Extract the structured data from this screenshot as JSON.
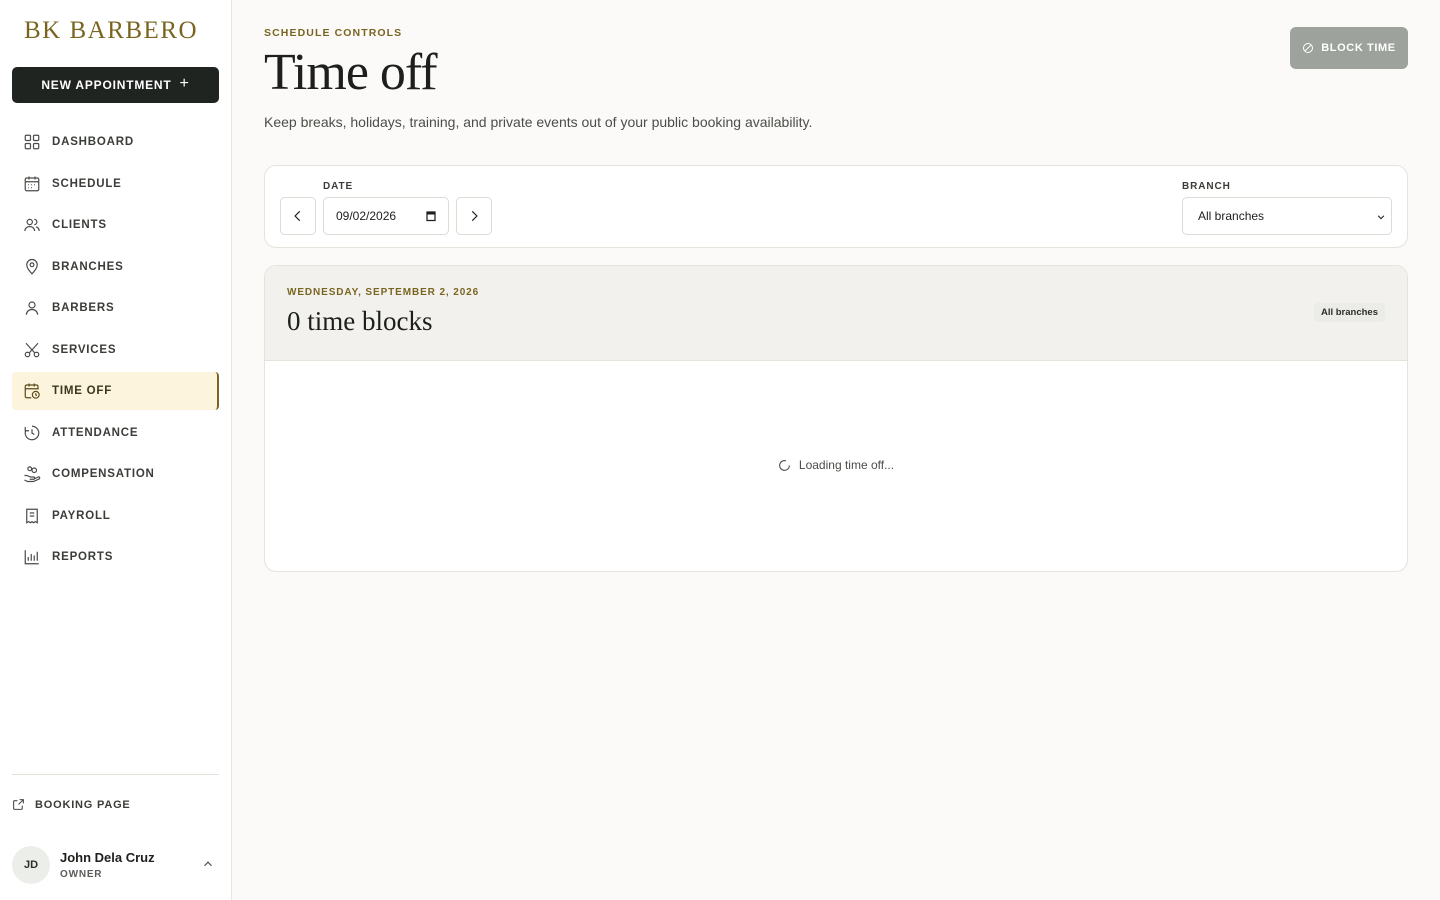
{
  "brand": {
    "name": "BK BARBERO",
    "accent": "#7a6520"
  },
  "sidebar": {
    "new_appointment_label": "NEW APPOINTMENT",
    "items": [
      {
        "label": "DASHBOARD",
        "icon": "grid-icon"
      },
      {
        "label": "SCHEDULE",
        "icon": "calendar-icon"
      },
      {
        "label": "CLIENTS",
        "icon": "users-icon"
      },
      {
        "label": "BRANCHES",
        "icon": "map-pin-icon"
      },
      {
        "label": "BARBERS",
        "icon": "user-icon"
      },
      {
        "label": "SERVICES",
        "icon": "scissors-icon"
      },
      {
        "label": "TIME OFF",
        "icon": "calendar-clock-icon",
        "active": true
      },
      {
        "label": "ATTENDANCE",
        "icon": "clock-icon"
      },
      {
        "label": "COMPENSATION",
        "icon": "hand-coins-icon"
      },
      {
        "label": "PAYROLL",
        "icon": "receipt-icon"
      },
      {
        "label": "REPORTS",
        "icon": "bar-chart-icon"
      }
    ],
    "booking_page_label": "BOOKING PAGE",
    "user": {
      "initials": "JD",
      "name": "John Dela Cruz",
      "role": "OWNER"
    }
  },
  "header": {
    "eyebrow": "SCHEDULE CONTROLS",
    "title": "Time off",
    "description": "Keep breaks, holidays, training, and private events out of your public booking availability.",
    "block_time_label": "BLOCK TIME"
  },
  "filters": {
    "date_label": "DATE",
    "date_value": "09/02/2026",
    "branch_label": "BRANCH",
    "branch_value": "All branches"
  },
  "list": {
    "date_heading": "WEDNESDAY, SEPTEMBER 2, 2026",
    "count_label": "0 time blocks",
    "branch_badge": "All branches",
    "loading_text": "Loading time off..."
  }
}
